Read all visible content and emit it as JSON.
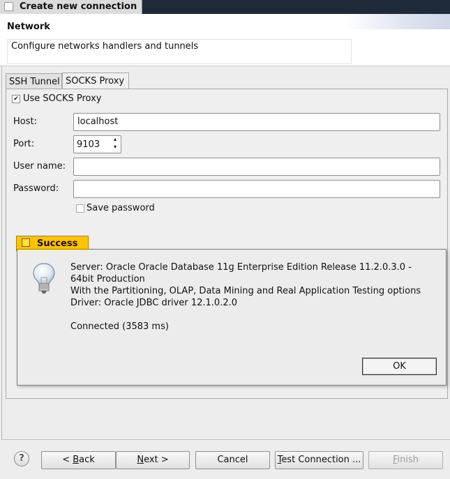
{
  "window": {
    "title": "Create new connection"
  },
  "header": {
    "title": "Network",
    "description": "Configure networks handlers and tunnels"
  },
  "tabs": [
    {
      "label": "SSH Tunnel",
      "selected": false
    },
    {
      "label": "SOCKS Proxy",
      "selected": true
    }
  ],
  "form": {
    "use_socks_label": "Use SOCKS Proxy",
    "use_socks_checked": true,
    "use_socks_mark": "✔",
    "host_label": "Host:",
    "host_value": "localhost",
    "port_label": "Port:",
    "port_value": "9103",
    "username_label": "User name:",
    "username_value": "",
    "password_label": "Password:",
    "password_value": "",
    "save_password_label": "Save password",
    "save_password_checked": false
  },
  "success_popup": {
    "tab_label": "Success",
    "icon": "lightbulb-icon",
    "lines": [
      "Server: Oracle Oracle Database 11g Enterprise Edition Release 11.2.0.3.0 -",
      "64bit Production",
      "With the Partitioning, OLAP, Data Mining and Real Application Testing options",
      "Driver: Oracle JDBC driver 12.1.0.2.0",
      "Connected (3583 ms)"
    ],
    "ok_label": "OK"
  },
  "footer": {
    "help_symbol": "?",
    "back_prefix": "< ",
    "back_mnemonic": "B",
    "back_rest": "ack",
    "next_mnemonic": "N",
    "next_rest": "ext >",
    "cancel_label": "Cancel",
    "test_mnemonic": "T",
    "test_rest": "est Connection ...",
    "finish_mnemonic": "F",
    "finish_rest": "inish",
    "finish_enabled": false
  },
  "colors": {
    "titlebar": "#1f2a38",
    "success_accent": "#ffc400",
    "window_bg": "#ededed"
  }
}
